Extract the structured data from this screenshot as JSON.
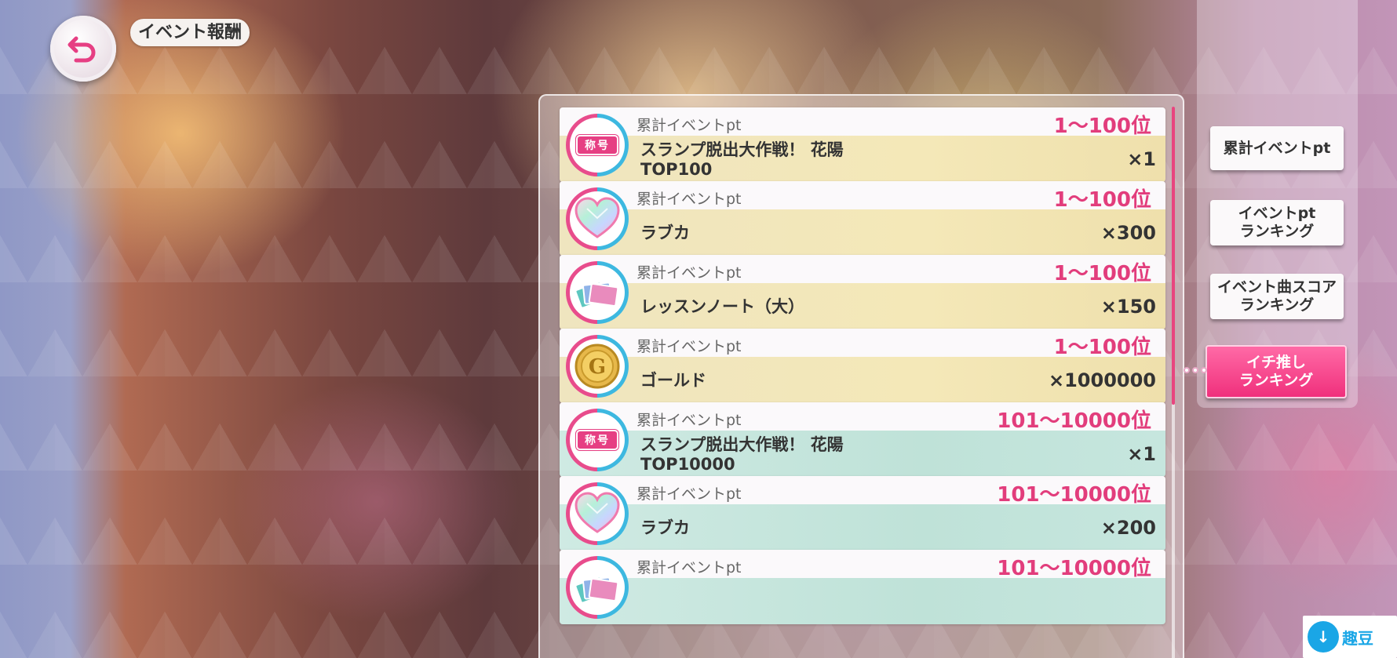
{
  "header": {
    "title": "イベント報酬"
  },
  "rewards": [
    {
      "category": "累計イベントpt",
      "rank": "1～100位",
      "name_line1": "スランプ脱出大作戦！ 花陽",
      "name_line2": "TOP100",
      "qty": "×1",
      "icon": "title-badge-icon",
      "badge": "称号",
      "tier": "gold"
    },
    {
      "category": "累計イベントpt",
      "rank": "1～100位",
      "name_line1": "ラブカ",
      "name_line2": "",
      "qty": "×300",
      "icon": "love-gem-heart-icon",
      "tier": "gold"
    },
    {
      "category": "累計イベントpt",
      "rank": "1～100位",
      "name_line1": "レッスンノート（大）",
      "name_line2": "",
      "qty": "×150",
      "icon": "lesson-note-icon",
      "tier": "gold"
    },
    {
      "category": "累計イベントpt",
      "rank": "1～100位",
      "name_line1": "ゴールド",
      "name_line2": "",
      "qty": "×1000000",
      "icon": "gold-coin-icon",
      "tier": "gold"
    },
    {
      "category": "累計イベントpt",
      "rank": "101～10000位",
      "name_line1": "スランプ脱出大作戦！ 花陽",
      "name_line2": "TOP10000",
      "qty": "×1",
      "icon": "title-badge-icon",
      "badge": "称号",
      "tier": "teal"
    },
    {
      "category": "累計イベントpt",
      "rank": "101～10000位",
      "name_line1": "ラブカ",
      "name_line2": "",
      "qty": "×200",
      "icon": "love-gem-heart-icon",
      "tier": "teal"
    },
    {
      "category": "累計イベントpt",
      "rank": "101～10000位",
      "name_line1": "",
      "name_line2": "",
      "qty": "",
      "icon": "lesson-note-icon",
      "tier": "teal"
    }
  ],
  "side_tabs": [
    {
      "label_line1": "累計イベントpt",
      "label_line2": "",
      "active": false
    },
    {
      "label_line1": "イベントpt",
      "label_line2": "ランキング",
      "active": false
    },
    {
      "label_line1": "イベント曲スコア",
      "label_line2": "ランキング",
      "active": false
    },
    {
      "label_line1": "イチ推し",
      "label_line2": "ランキング",
      "active": true
    }
  ],
  "watermark": {
    "text": "趣豆"
  },
  "colors": {
    "accent": "#e63f83",
    "rank_text": "#e23d7c",
    "gold_row": "#f2e6b8",
    "teal_row": "#c6e6de"
  }
}
